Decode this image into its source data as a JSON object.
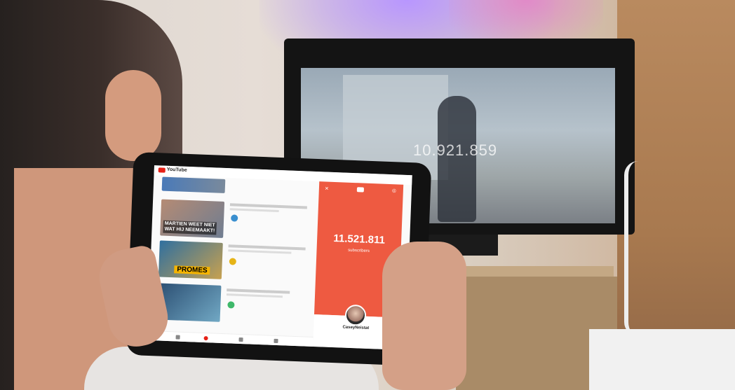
{
  "tablet": {
    "app": "YouTube",
    "videos": [
      {
        "caption": ""
      },
      {
        "caption": "MARTIEN WEET NIET\nWAT HIJ NEEMAAKT!"
      },
      {
        "caption": "PROMES"
      },
      {
        "caption": ""
      }
    ],
    "subscriber_panel": {
      "count": "11.521.811",
      "label": "subscribers",
      "channel_name": "CaseyNeistat"
    }
  },
  "tv": {
    "count": "10.921.859"
  }
}
